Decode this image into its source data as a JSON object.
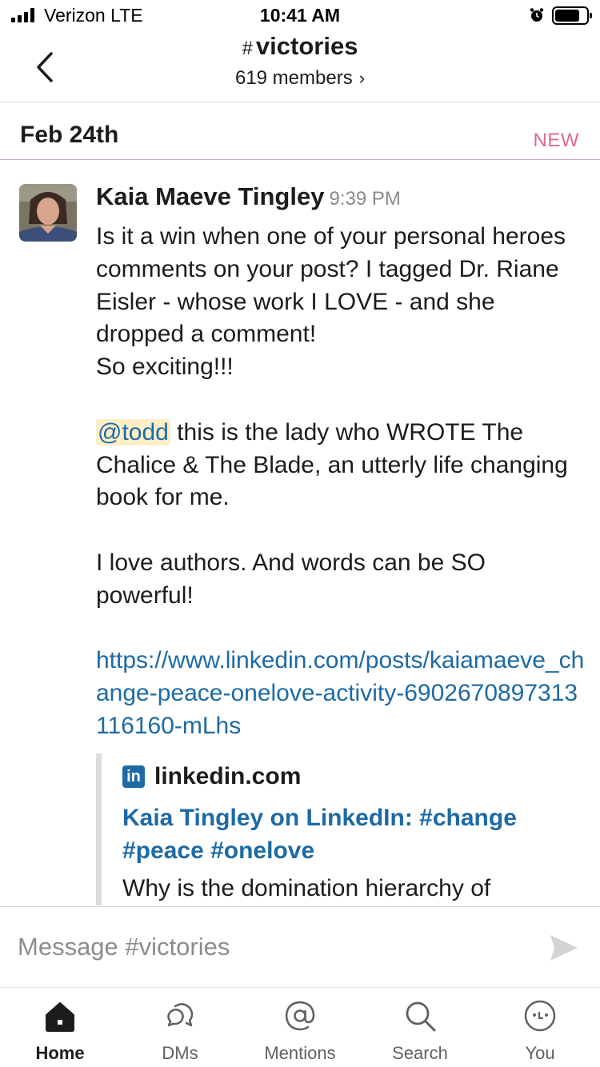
{
  "status_bar": {
    "carrier": "Verizon  LTE",
    "time": "10:41 AM"
  },
  "header": {
    "hash": "#",
    "channel": "victories",
    "members": "619 members"
  },
  "date_divider": {
    "date": "Feb 24th",
    "new_label": "NEW"
  },
  "message": {
    "author": "Kaia Maeve Tingley",
    "time": "9:39 PM",
    "paragraph1": "Is it a win when one of your personal heroes comments on your post? I tagged Dr. Riane Eisler - whose work I LOVE - and she dropped a comment!\nSo exciting!!!",
    "mention": "@todd",
    "paragraph2_rest": " this is the lady who WROTE The Chalice & The Blade, an utterly life changing book for me.",
    "paragraph3": "I love authors. And words can be SO powerful!",
    "link": "https://www.linkedin.com/posts/kaiamaeve_change-peace-onelove-activity-6902670897313116160-mLhs"
  },
  "unfurl": {
    "icon": "in",
    "source": "linkedin.com",
    "title": "Kaia Tingley on LinkedIn: #change #peace #onelove",
    "description": "Why is the domination hierarchy of"
  },
  "composer": {
    "placeholder": "Message #victories"
  },
  "tabs": [
    {
      "label": "Home",
      "icon": "home-icon"
    },
    {
      "label": "DMs",
      "icon": "dms-icon"
    },
    {
      "label": "Mentions",
      "icon": "mentions-icon"
    },
    {
      "label": "Search",
      "icon": "search-icon"
    },
    {
      "label": "You",
      "icon": "you-icon"
    }
  ]
}
